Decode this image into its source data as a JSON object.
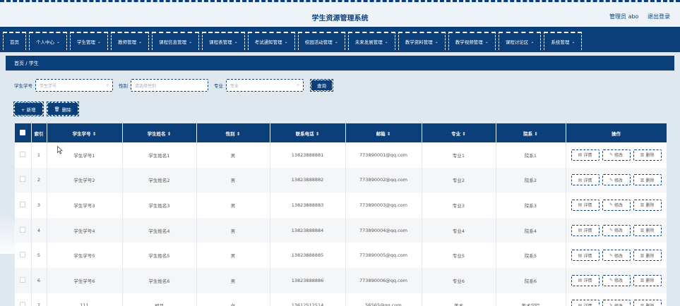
{
  "header": {
    "title": "学生资源管理系统",
    "user": "管理员 abo",
    "logout": "退出登录"
  },
  "nav": [
    {
      "label": "首页",
      "chevron": false
    },
    {
      "label": "个人中心",
      "chevron": true
    },
    {
      "label": "学生管理",
      "chevron": true
    },
    {
      "label": "教师管理",
      "chevron": true
    },
    {
      "label": "课程信息管理",
      "chevron": true
    },
    {
      "label": "课程表管理",
      "chevron": true
    },
    {
      "label": "考试通知管理",
      "chevron": true
    },
    {
      "label": "校园活动管理",
      "chevron": true
    },
    {
      "label": "未来发展管理",
      "chevron": true
    },
    {
      "label": "教学资料管理",
      "chevron": true
    },
    {
      "label": "教学视频管理",
      "chevron": true
    },
    {
      "label": "课程讨论区",
      "chevron": true
    },
    {
      "label": "系统管理",
      "chevron": true
    }
  ],
  "breadcrumb": "首页 / 学生",
  "search": {
    "fields": [
      {
        "label": "学生学号",
        "placeholder": "学生学号"
      },
      {
        "label": "性别",
        "placeholder": "请选择性别"
      },
      {
        "label": "专业",
        "placeholder": "专业"
      }
    ],
    "button": "查询"
  },
  "ops": {
    "add": "+ 新增",
    "delete": "删除"
  },
  "table": {
    "headers": [
      "索引",
      "学生学号 ⇕",
      "学生姓名 ⇕",
      "性别 ⇕",
      "联系电话 ⇕",
      "邮箱 ⇕",
      "专业 ⇕",
      "院系 ⇕",
      "操作"
    ],
    "actions": {
      "detail": "详情",
      "edit": "修改",
      "remove": "删除"
    },
    "rows": [
      [
        "1",
        "学生学号1",
        "学生姓名1",
        "男",
        "13823888881",
        "773890001@qq.com",
        "专业1",
        "院系1"
      ],
      [
        "2",
        "学生学号2",
        "学生姓名2",
        "男",
        "13823888882",
        "773890002@qq.com",
        "专业2",
        "院系2"
      ],
      [
        "3",
        "学生学号3",
        "学生姓名3",
        "男",
        "13823888883",
        "773890003@qq.com",
        "专业3",
        "院系3"
      ],
      [
        "4",
        "学生学号4",
        "学生姓名4",
        "男",
        "13823888884",
        "773890004@qq.com",
        "专业4",
        "院系4"
      ],
      [
        "5",
        "学生学号5",
        "学生姓名5",
        "男",
        "13823888885",
        "773890005@qq.com",
        "专业5",
        "院系5"
      ],
      [
        "6",
        "学生学号6",
        "学生姓名6",
        "男",
        "13823888886",
        "773890006@qq.com",
        "专业6",
        "院系6"
      ],
      [
        "7",
        "111",
        "胡月",
        "女",
        "13612512514",
        "56565@qq.com",
        "美术",
        "美术学院"
      ]
    ]
  },
  "colors": {
    "primary": "#0b3f7a",
    "background": "#dfe7ef"
  }
}
